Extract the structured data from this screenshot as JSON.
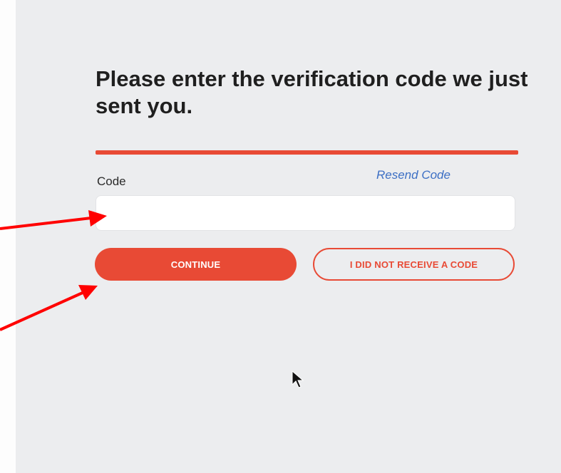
{
  "heading": "Please enter the verification code we just sent you.",
  "form": {
    "code_label": "Code",
    "resend_link": "Resend Code",
    "code_value": "",
    "code_placeholder": ""
  },
  "buttons": {
    "continue": "CONTINUE",
    "no_code": "I DID NOT RECEIVE A CODE"
  },
  "colors": {
    "accent": "#e84a35",
    "link": "#3c6fc4",
    "background": "#ecedef",
    "annotation_arrow": "#ff0000"
  },
  "icons": [
    "annotation-arrow-icon",
    "mouse-cursor-icon"
  ]
}
